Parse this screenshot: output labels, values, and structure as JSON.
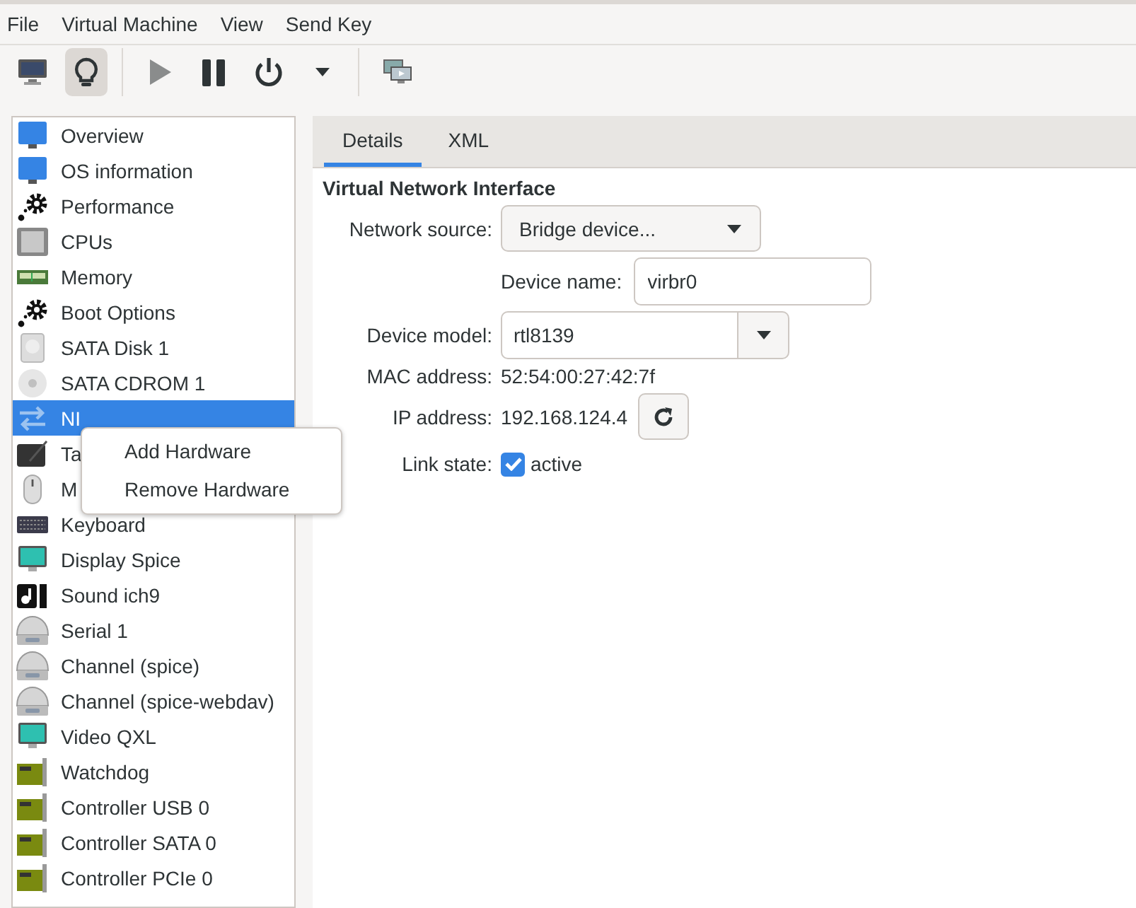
{
  "menu_bar": [
    "File",
    "Virtual Machine",
    "View",
    "Send Key"
  ],
  "toolbar": [
    {
      "kind": "console",
      "selected": false
    },
    {
      "kind": "details",
      "selected": true
    },
    {
      "kind": "sep"
    },
    {
      "kind": "run",
      "disabled": true
    },
    {
      "kind": "pause",
      "disabled": false
    },
    {
      "kind": "power",
      "disabled": false
    },
    {
      "kind": "caret",
      "disabled": false
    },
    {
      "kind": "sep"
    },
    {
      "kind": "snapshots"
    }
  ],
  "sidebar": {
    "items": [
      {
        "label": "Overview",
        "kind": "monitor",
        "selected": false
      },
      {
        "label": "OS information",
        "kind": "monitor",
        "selected": false
      },
      {
        "label": "Performance",
        "kind": "gear",
        "selected": false
      },
      {
        "label": "CPUs",
        "kind": "chip",
        "selected": false
      },
      {
        "label": "Memory",
        "kind": "memory",
        "selected": false
      },
      {
        "label": "Boot Options",
        "kind": "gear",
        "selected": false
      },
      {
        "label": "SATA Disk 1",
        "kind": "disk",
        "selected": false
      },
      {
        "label": "SATA CDROM 1",
        "kind": "cdrom",
        "selected": false
      },
      {
        "label": "NI",
        "kind": "nic",
        "selected": true
      },
      {
        "label": "Ta",
        "kind": "tablet",
        "selected": false
      },
      {
        "label": "M",
        "kind": "mouse",
        "selected": false
      },
      {
        "label": "Keyboard",
        "kind": "keyboard",
        "selected": false
      },
      {
        "label": "Display Spice",
        "kind": "display",
        "selected": false
      },
      {
        "label": "Sound ich9",
        "kind": "sound",
        "selected": false
      },
      {
        "label": "Serial 1",
        "kind": "serial",
        "selected": false
      },
      {
        "label": "Channel (spice)",
        "kind": "serial",
        "selected": false
      },
      {
        "label": "Channel (spice-webdav)",
        "kind": "serial",
        "selected": false
      },
      {
        "label": "Video QXL",
        "kind": "display",
        "selected": false
      },
      {
        "label": "Watchdog",
        "kind": "card",
        "selected": false
      },
      {
        "label": "Controller USB 0",
        "kind": "card",
        "selected": false
      },
      {
        "label": "Controller SATA 0",
        "kind": "card",
        "selected": false
      },
      {
        "label": "Controller PCIe 0",
        "kind": "card",
        "selected": false
      }
    ]
  },
  "context_menu": [
    "Add Hardware",
    "Remove Hardware"
  ],
  "tabs": [
    {
      "label": "Details",
      "selected": true
    },
    {
      "label": "XML",
      "selected": false
    }
  ],
  "section_title": "Virtual Network Interface",
  "form": {
    "network_source": {
      "label": "Network source:",
      "value": "Bridge device..."
    },
    "device_name": {
      "label": "Device name:",
      "value": "virbr0"
    },
    "device_model": {
      "label": "Device model:",
      "value": "rtl8139"
    },
    "mac_address": {
      "label": "MAC address:",
      "value": "52:54:00:27:42:7f"
    },
    "ip_address": {
      "label": "IP address:",
      "value": "192.168.124.4"
    },
    "link_state": {
      "label": "Link state:",
      "option": "active",
      "checked": true
    }
  }
}
